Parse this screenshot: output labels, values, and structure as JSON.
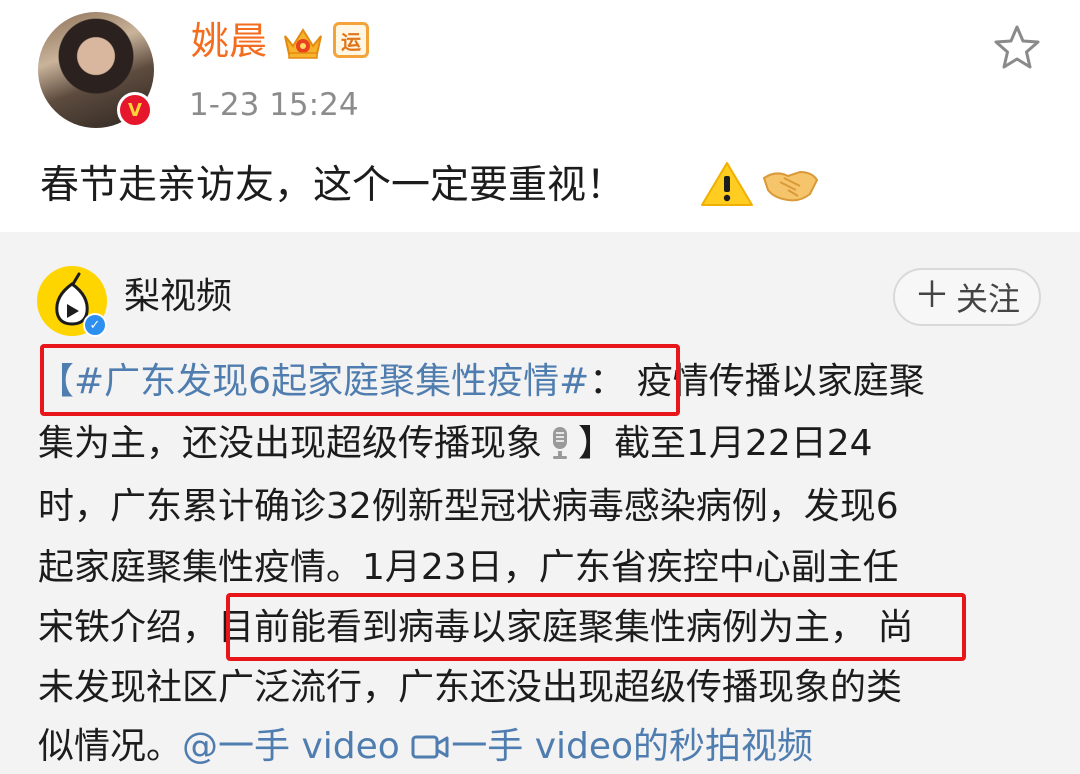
{
  "author": {
    "name": "姚晨",
    "badge_text": "运",
    "timestamp": "1-23 15:24",
    "avatar_badge": "V"
  },
  "post": {
    "text": "春节走亲访友，这个一定要重视！",
    "emojis": [
      "warning-icon",
      "handshake-icon"
    ]
  },
  "repost": {
    "source_name": "梨视频",
    "follow_label": "关注",
    "follow_plus": "＋",
    "lines": {
      "l1_bracket_open": "【",
      "l1_hashtag": "#广东发现6起家庭聚集性疫情#",
      "l1_colon": "：",
      "l1_rest": "疫情传播以家庭聚",
      "l2_a": "集为主，还没出现超级传播现象",
      "l2_b": "】截至1月22日24",
      "l3": "时，广东累计确诊32例新型冠状病毒感染病例，发现6",
      "l4": "起家庭聚集性疫情。1月23日，广东省疾控中心副主任",
      "l5_a": "宋铁介绍，",
      "l5_highlight": "目前能看到病毒以家庭聚集性病例为主，",
      "l5_b": "尚",
      "l6": "未发现社区广泛流行，广东还没出现超级传播现象的类",
      "l7_a": "似情况。",
      "l7_mention": "@一手 video",
      "l7_video_link": "一手 video的秒拍视频"
    }
  },
  "colors": {
    "username": "#f46d1e",
    "link": "#507daf",
    "highlight_box": "#e8161b",
    "repost_bg": "#f3f3f3"
  }
}
